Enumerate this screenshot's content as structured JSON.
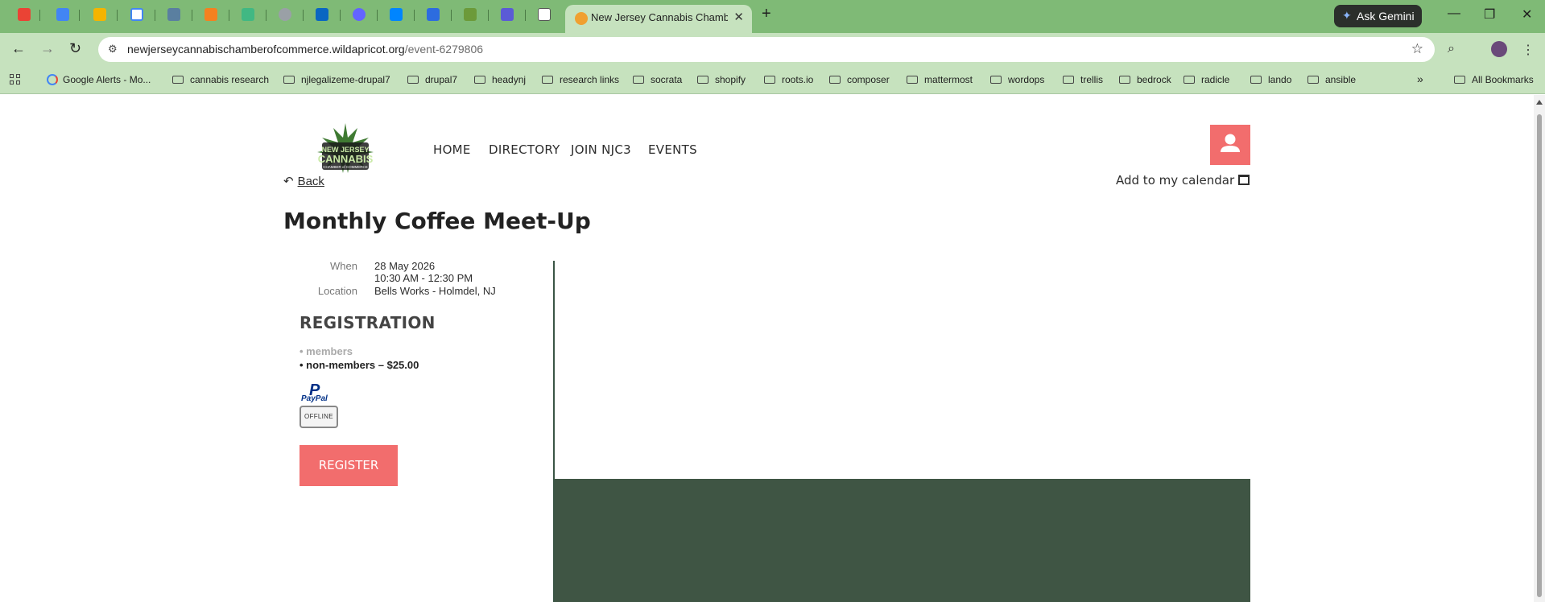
{
  "browser": {
    "tab_title": "New Jersey Cannabis Chamber",
    "ask_gemini_label": "Ask Gemini",
    "url_host": "newjerseycannabischamberofcommerce.wildapricot.org",
    "url_path": "/event-6279806",
    "bookmarks": [
      {
        "label": "Google Alerts - Mo...",
        "type": "link"
      },
      {
        "label": "cannabis research",
        "type": "folder"
      },
      {
        "label": "njlegalizeme-drupal7",
        "type": "folder"
      },
      {
        "label": "drupal7",
        "type": "folder"
      },
      {
        "label": "headynj",
        "type": "folder"
      },
      {
        "label": "research links",
        "type": "folder"
      },
      {
        "label": "socrata",
        "type": "folder"
      },
      {
        "label": "shopify",
        "type": "folder"
      },
      {
        "label": "roots.io",
        "type": "folder"
      },
      {
        "label": "composer",
        "type": "folder"
      },
      {
        "label": "mattermost",
        "type": "folder"
      },
      {
        "label": "wordops",
        "type": "folder"
      },
      {
        "label": "trellis",
        "type": "folder"
      },
      {
        "label": "bedrock",
        "type": "folder"
      },
      {
        "label": "radicle",
        "type": "folder"
      },
      {
        "label": "lando",
        "type": "folder"
      },
      {
        "label": "ansible",
        "type": "folder"
      }
    ],
    "all_bookmarks_label": "All Bookmarks",
    "colors": {
      "tabbar": "#7fba76",
      "toolbar": "#c6e2be"
    }
  },
  "site": {
    "nav": [
      "HOME",
      "DIRECTORY",
      "JOIN NJC3",
      "EVENTS"
    ],
    "accent_color": "#f26d6d"
  },
  "event": {
    "back_label": "Back",
    "add_calendar_label": "Add to my calendar",
    "title": "Monthly Coffee Meet-Up",
    "when_label": "When",
    "date": "28 May 2026",
    "time": "10:30 AM - 12:30 PM",
    "location_label": "Location",
    "location": "Bells Works - Holmdel, NJ",
    "registration_heading": "REGISTRATION",
    "registration_types": [
      {
        "label": "members",
        "available": false
      },
      {
        "label": "non-members – $25.00",
        "available": true
      }
    ],
    "paypal_label": "PayPal",
    "offline_label": "OFFLINE",
    "register_button": "REGISTER"
  }
}
